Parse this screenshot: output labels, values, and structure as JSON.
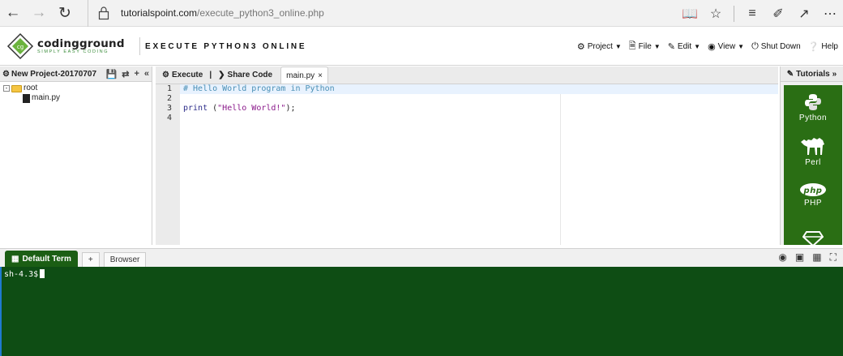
{
  "browser": {
    "url_host": "tutorialspoint.com",
    "url_path": "/execute_python3_online.php",
    "nav_icons": [
      "back-icon",
      "forward-icon",
      "refresh-icon"
    ],
    "right_icons": [
      "reading-view-icon",
      "favorite-star-icon",
      "hub-icon",
      "notes-pen-icon",
      "share-icon",
      "more-icon"
    ]
  },
  "header": {
    "logo_main": "codingground",
    "logo_sub": "SIMPLY EASY CODING",
    "title": "EXECUTE PYTHON3 ONLINE",
    "menu": {
      "project": "Project",
      "file": "File",
      "edit": "Edit",
      "view": "View",
      "shutdown": "Shut Down",
      "help": "Help"
    }
  },
  "project": {
    "name": "New Project-20170707",
    "tree": {
      "root": "root",
      "file": "main.py"
    }
  },
  "editor": {
    "execute_label": "Execute",
    "separator": "|",
    "share_label": "Share Code",
    "tab_label": "main.py",
    "tab_close": "×",
    "line_numbers": [
      "1",
      "2",
      "3",
      "4"
    ],
    "lines": {
      "l1": "# Hello World program in Python",
      "l2": "",
      "l3_kw": "print",
      "l3_open": " (",
      "l3_str": "\"Hello World!\"",
      "l3_close": ");",
      "l4": ""
    }
  },
  "tutorials": {
    "header": "Tutorials",
    "items": [
      "Python",
      "Perl",
      "PHP"
    ]
  },
  "terminal": {
    "tab_active": "Default Term",
    "tab_plus": "+",
    "tab_browser": "Browser",
    "prompt": "sh-4.3$"
  },
  "colors": {
    "terminal_bg": "#0e4d14",
    "tutorials_bg": "#2a6e14",
    "active_line": "#e8f2fe"
  }
}
